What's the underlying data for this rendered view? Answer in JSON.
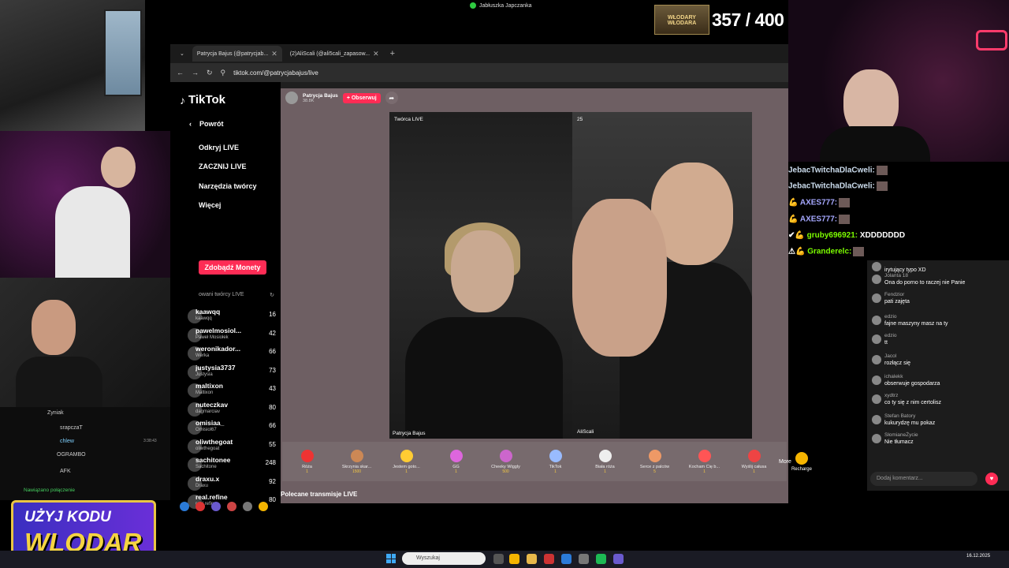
{
  "top": {
    "window_title": "Jabłuszka Japczanka",
    "counter_logo": "WŁODARY WŁODARA",
    "counter": "357 / 400"
  },
  "browser": {
    "tabs": [
      {
        "label": "Patrycja Bajus (@patrycjab..."
      },
      {
        "label": "(2)AliScali (@ali5cali_zapasow..."
      }
    ],
    "url": "tiktok.com/@patrycjabajus/live"
  },
  "sidebar": {
    "logo": "TikTok",
    "back": "Powrót",
    "items": [
      {
        "label": "Odkryj LIVE"
      },
      {
        "label": "ZACZNIJ LIVE"
      },
      {
        "label": "Narzędzia twórcy"
      },
      {
        "label": "Więcej"
      }
    ],
    "gold_button": "Zdobądź Monety",
    "followed_header": "owani twórcy LIVE",
    "creators": [
      {
        "name": "kaawqq",
        "sub": "kaawqq",
        "count": "16"
      },
      {
        "name": "pawelmosiol...",
        "sub": "Paweł Mosiołek",
        "count": "42"
      },
      {
        "name": "weronikador...",
        "sub": "Werka",
        "count": "66"
      },
      {
        "name": "justysia3737",
        "sub": "Justysia",
        "count": "73"
      },
      {
        "name": "maltixon",
        "sub": "Maltixon",
        "count": "43"
      },
      {
        "name": "nuteczkav",
        "sub": "dagmarciav",
        "count": "80"
      },
      {
        "name": "omisiaa_",
        "sub": "Omisiol67",
        "count": "66"
      },
      {
        "name": "oliwthegoat",
        "sub": "oliwthegoat",
        "count": "55"
      },
      {
        "name": "sachitonee",
        "sub": "Sachitone",
        "count": "248"
      },
      {
        "name": "draxu.x",
        "sub": "Draxu",
        "count": "92"
      },
      {
        "name": "real.refine",
        "sub": "real.refine",
        "count": "80"
      }
    ]
  },
  "live": {
    "host_name": "Patrycja Bajus",
    "host_likes": "38.8K",
    "follow_label": "+ Obserwuj",
    "left_badge": "Twórca LIVE",
    "left_name": "Patrycja Bajus",
    "right_viewers": "25",
    "right_name": "AliScali",
    "gifts": [
      {
        "name": "Róża",
        "price": "1"
      },
      {
        "name": "Skrzynia skar...",
        "price": "1500"
      },
      {
        "name": "Jestem goto...",
        "price": "1"
      },
      {
        "name": "GG",
        "price": "1"
      },
      {
        "name": "Cheeky Wiggly",
        "price": "500"
      },
      {
        "name": "TikTok",
        "price": "1"
      },
      {
        "name": "Biała róża",
        "price": "1"
      },
      {
        "name": "Serce z palców",
        "price": "5"
      },
      {
        "name": "Kocham Cię b...",
        "price": "1"
      },
      {
        "name": "Wyślij całusa",
        "price": "1"
      }
    ],
    "more": "More",
    "recharge": "Recharge",
    "recommended": "Polecane transmisje LIVE"
  },
  "tiktok_chat": {
    "messages": [
      {
        "user": "",
        "text": "irytujący typo XD"
      },
      {
        "user": "Jolanta 18",
        "text": "Ona do porno to raczej nie Panie"
      },
      {
        "user": "Fendzior",
        "text": "pati zajęta"
      },
      {
        "user": "edzio",
        "text": "fajne maszyny masz na ty"
      },
      {
        "user": "edzio",
        "text": "tt"
      },
      {
        "user": "Jacol",
        "text": "rozłącz się"
      },
      {
        "user": "ichalekk",
        "text": "obserwuje gospodarza"
      },
      {
        "user": "xydtrz",
        "text": "co ty się z nim certolisz"
      },
      {
        "user": "Stefan Batory",
        "text": "kukurydzę mu pokaz"
      },
      {
        "user": "SłomianeŻycie",
        "text": "Nie tłumacz"
      }
    ],
    "input_placeholder": "Dodaj komentarz..."
  },
  "twitch_overlay": [
    {
      "user": "JebacTwitchaDlaCweli:",
      "text": ""
    },
    {
      "user": "JebacTwitchaDlaCweli:",
      "text": ""
    },
    {
      "user": "AXES777:",
      "text": ""
    },
    {
      "user": "AXES777:",
      "text": ""
    },
    {
      "user": "gruby696921:",
      "text": "XDDDDDDD"
    },
    {
      "user": "Granderelc:",
      "text": ""
    }
  ],
  "left_chat": {
    "lines": [
      {
        "text": "Zyniak"
      },
      {
        "text": "srapczaT"
      },
      {
        "text": "chlew"
      },
      {
        "text": "OGRAMBO"
      },
      {
        "text": "AFK"
      }
    ],
    "time": "3:38:43",
    "connection": "Nawiązano połączenie"
  },
  "promo": {
    "line1": "UŻYJ KODU",
    "line2": "WLODAR"
  },
  "taskbar": {
    "search": "Wyszukaj",
    "time": "",
    "date": "16.12.2025"
  }
}
